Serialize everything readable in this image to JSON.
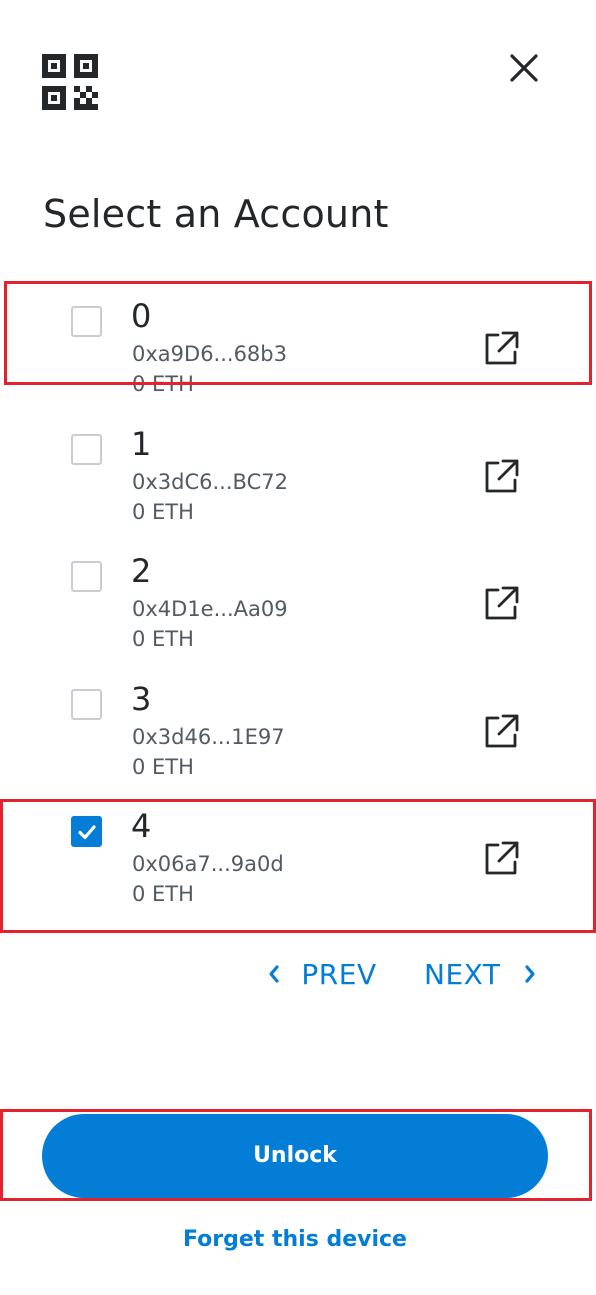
{
  "header": {
    "qr_icon": "qr-code-icon",
    "close_icon": "close-icon",
    "title": "Select an Account"
  },
  "accounts": [
    {
      "index": "0",
      "address": "0xa9D6...68b3",
      "balance": "0 ETH",
      "checked": false
    },
    {
      "index": "1",
      "address": "0x3dC6...BC72",
      "balance": "0 ETH",
      "checked": false
    },
    {
      "index": "2",
      "address": "0x4D1e...Aa09",
      "balance": "0 ETH",
      "checked": false
    },
    {
      "index": "3",
      "address": "0x3d46...1E97",
      "balance": "0 ETH",
      "checked": false
    },
    {
      "index": "4",
      "address": "0x06a7...9a0d",
      "balance": "0 ETH",
      "checked": true
    }
  ],
  "pagination": {
    "prev_label": "PREV",
    "next_label": "NEXT"
  },
  "actions": {
    "unlock_label": "Unlock",
    "forget_label": "Forget this device"
  },
  "colors": {
    "accent": "#037dd6",
    "highlight": "#e4222e",
    "text_primary": "#24272a",
    "text_secondary": "#535a61"
  }
}
